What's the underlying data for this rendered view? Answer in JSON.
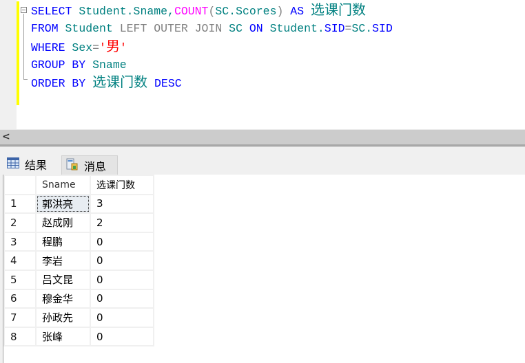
{
  "editor": {
    "lines": [
      {
        "segments": [
          {
            "t": "SELECT",
            "c": "kw"
          },
          {
            "t": " Student.Sname,",
            "c": "id"
          },
          {
            "t": "COUNT",
            "c": "fn"
          },
          {
            "t": "(",
            "c": "gr"
          },
          {
            "t": "SC.Scores",
            "c": "id"
          },
          {
            "t": ")",
            "c": "gr"
          },
          {
            "t": " AS ",
            "c": "kw"
          },
          {
            "t": "选课门数",
            "c": "id cjk"
          }
        ]
      },
      {
        "segments": [
          {
            "t": "FROM",
            "c": "kw"
          },
          {
            "t": " Student ",
            "c": "id"
          },
          {
            "t": "LEFT OUTER JOIN",
            "c": "gr"
          },
          {
            "t": " SC ",
            "c": "id"
          },
          {
            "t": "ON",
            "c": "kw"
          },
          {
            "t": " Student.",
            "c": "id"
          },
          {
            "t": "SID",
            "c": "kw"
          },
          {
            "t": "=",
            "c": "gr"
          },
          {
            "t": "SC.",
            "c": "id"
          },
          {
            "t": "SID",
            "c": "kw"
          }
        ]
      },
      {
        "segments": [
          {
            "t": "WHERE",
            "c": "kw"
          },
          {
            "t": " Sex",
            "c": "id"
          },
          {
            "t": "=",
            "c": "gr"
          },
          {
            "t": "'",
            "c": "str"
          },
          {
            "t": "男",
            "c": "cjk-red"
          },
          {
            "t": "'",
            "c": "str"
          }
        ]
      },
      {
        "segments": [
          {
            "t": "GROUP BY",
            "c": "kw"
          },
          {
            "t": " Sname",
            "c": "id"
          }
        ]
      },
      {
        "segments": [
          {
            "t": "ORDER BY",
            "c": "kw"
          },
          {
            "t": " ",
            "c": "id"
          },
          {
            "t": "选课门数",
            "c": "id cjk"
          },
          {
            "t": " DESC",
            "c": "kw"
          }
        ]
      }
    ]
  },
  "scrollbar": {
    "left_arrow": "<"
  },
  "tabs": [
    {
      "label": "结果",
      "icon": "grid-icon"
    },
    {
      "label": "消息",
      "icon": "messages-icon"
    }
  ],
  "grid": {
    "columns": [
      "",
      "Sname",
      "选课门数"
    ],
    "rows": [
      [
        "1",
        "郭洪亮",
        "3"
      ],
      [
        "2",
        "赵成刚",
        "2"
      ],
      [
        "3",
        "程鹏",
        "0"
      ],
      [
        "4",
        "李岩",
        "0"
      ],
      [
        "5",
        "吕文昆",
        "0"
      ],
      [
        "6",
        "穆金华",
        "0"
      ],
      [
        "7",
        "孙政先",
        "0"
      ],
      [
        "8",
        "张峰",
        "0"
      ]
    ],
    "selected_cell": {
      "row": 0,
      "col": 1
    }
  }
}
